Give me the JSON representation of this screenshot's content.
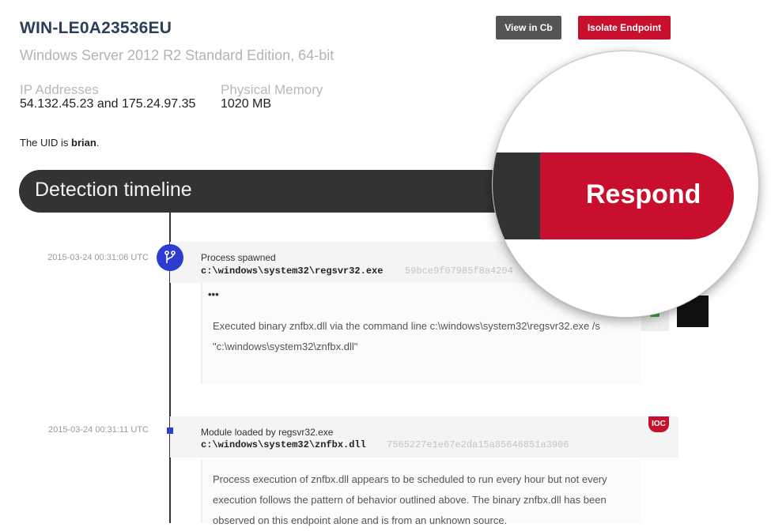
{
  "host": {
    "name": "WIN-LE0A23536EU",
    "os": "Windows Server 2012 R2 Standard Edition, 64-bit",
    "ip_label": "IP Addresses",
    "ip_value": "54.132.45.23 and 175.24.97.35",
    "mem_label": "Physical Memory",
    "mem_value": "1020 MB",
    "uid_prefix": "The UID is",
    "uid_value": "brian",
    "uid_suffix": "."
  },
  "toolbar": {
    "view_label": "View in Cb",
    "isolate_label": "Isolate Endpoint"
  },
  "timeline": {
    "title": "Detection timeline",
    "respond_label": "Respond",
    "events": [
      {
        "timestamp": "2015-03-24 00:31:06 UTC",
        "label": "Process spawned",
        "path": "c:\\windows\\system32\\regsvr32.exe",
        "hash": "59bce9f07985f8a4204",
        "ellipsis": "•••",
        "detail_line1": "Executed binary znfbx.dll via the command line c:\\windows\\system32\\regsvr32.exe /s",
        "detail_line2": "\"c:\\windows\\system32\\znfbx.dll\""
      },
      {
        "timestamp": "2015-03-24 00:31:11 UTC",
        "label": "Module loaded by regsvr32.exe",
        "path": "c:\\windows\\system32\\znfbx.dll",
        "hash": "7565227e1e67e2da15a85646851a3906",
        "badge": "IOC",
        "detail_line1": "Process execution of znfbx.dll appears to be scheduled to run every hour but not every",
        "detail_line2": "execution follows the pattern of behavior outlined above. The binary znfbx.dll has been",
        "detail_line3": "observed on this endpoint alone and is from an unknown source."
      }
    ]
  },
  "colors": {
    "accent_red": "#c8102e",
    "timeline_dark": "#333333",
    "event_blue": "#2d3bd1",
    "lock_green": "#3aa935"
  },
  "icons": {
    "process_icon": "branch-icon",
    "lock_icon": "lock-icon"
  }
}
